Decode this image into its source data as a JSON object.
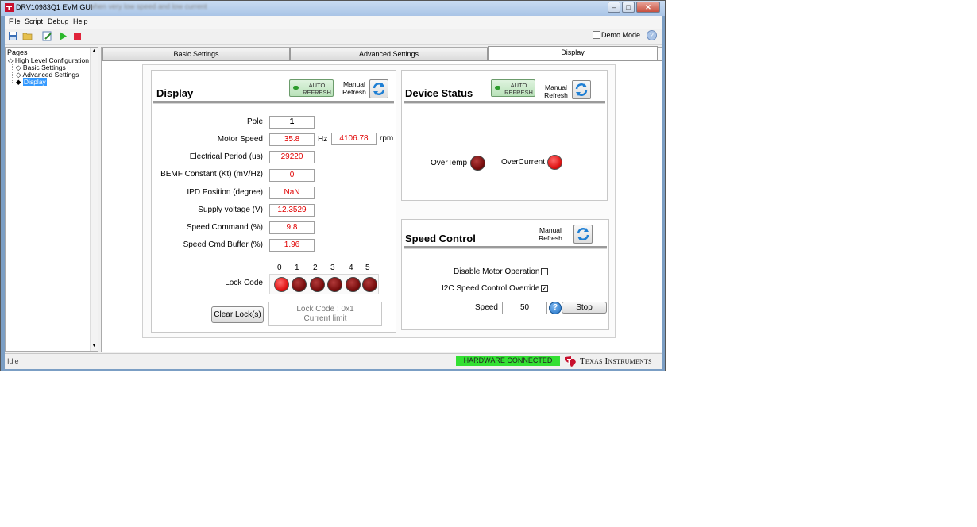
{
  "window": {
    "title": "DRV10983Q1 EVM GUI",
    "title_suffix_blurred": "- when very low speed and low current"
  },
  "menu": [
    "File",
    "Script",
    "Debug",
    "Help"
  ],
  "toolbar": {
    "demo_mode_label": "Demo Mode",
    "demo_mode_checked": false,
    "help": "?"
  },
  "tree": {
    "header": "Pages",
    "items": [
      {
        "label": "High Level Configuration",
        "level": 0,
        "bullet": "◇"
      },
      {
        "label": "Basic Settings",
        "level": 1,
        "bullet": "◇"
      },
      {
        "label": "Advanced Settings",
        "level": 1,
        "bullet": "◇"
      },
      {
        "label": "Display",
        "level": 1,
        "bullet": "◆",
        "selected": true
      }
    ]
  },
  "tabs": [
    {
      "label": "Basic Settings",
      "active": false
    },
    {
      "label": "Advanced Settings",
      "active": false
    },
    {
      "label": "Display",
      "active": true
    }
  ],
  "display_panel": {
    "title": "Display",
    "auto_refresh": "AUTO REFRESH",
    "manual_refresh": [
      "Manual",
      "Refresh"
    ],
    "rows": [
      {
        "label": "Pole",
        "value": "1"
      },
      {
        "label": "Motor Speed",
        "value": "35.8",
        "unit": "Hz",
        "value2": "4106.78",
        "unit2": "rpm"
      },
      {
        "label": "Electrical Period (us)",
        "value": "29220"
      },
      {
        "label": "BEMF Constant (Kt) (mV/Hz)",
        "value": "0"
      },
      {
        "label": "IPD Position (degree)",
        "value": "NaN"
      },
      {
        "label": "Supply voltage (V)",
        "value": "12.3529"
      },
      {
        "label": "Speed Command (%)",
        "value": "9.8"
      },
      {
        "label": "Speed Cmd Buffer (%)",
        "value": "1.96"
      }
    ],
    "lock_code": {
      "label": "Lock Code",
      "indices": [
        "0",
        "1",
        "2",
        "3",
        "4",
        "5"
      ],
      "states": [
        "on",
        "off",
        "off",
        "off",
        "off",
        "off"
      ]
    },
    "clear_lock_button": "Clear Lock(s)",
    "lock_message": [
      "Lock Code : 0x1",
      "Current limit"
    ]
  },
  "device_status": {
    "title": "Device Status",
    "auto_refresh": "AUTO REFRESH",
    "manual_refresh": [
      "Manual",
      "Refresh"
    ],
    "overtemp_label": "OverTemp",
    "overtemp_state": "off",
    "overcurrent_label": "OverCurrent",
    "overcurrent_state": "on"
  },
  "speed_control": {
    "title": "Speed Control",
    "manual_refresh": [
      "Manual",
      "Refresh"
    ],
    "disable_motor_label": "Disable Motor Operation",
    "disable_motor_checked": false,
    "i2c_override_label": "I2C Speed Control Override",
    "i2c_override_checked": true,
    "speed_label": "Speed",
    "speed_value": "50",
    "help": "?",
    "stop_button": "Stop"
  },
  "statusbar": {
    "status": "Idle",
    "hardware": "HARDWARE CONNECTED",
    "brand": "Texas Instruments"
  },
  "colors": {
    "value_text": "#e00000",
    "hw_connected": "#33e033",
    "led_on": "#e01616",
    "led_off": "#7a0f0f",
    "selection": "#3399ff"
  }
}
